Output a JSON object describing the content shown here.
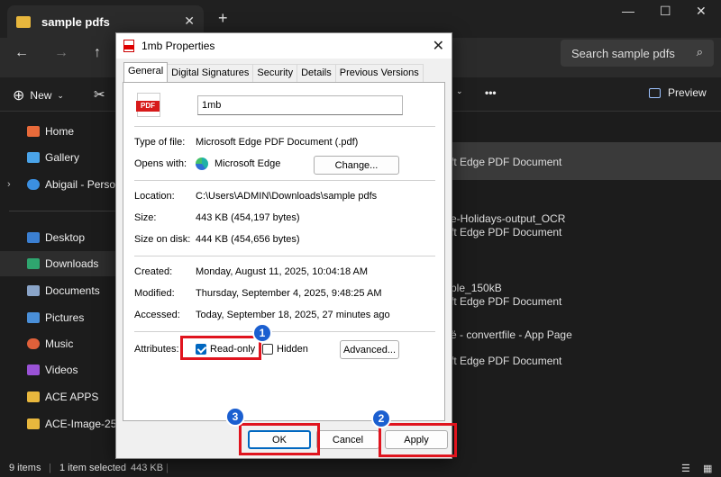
{
  "explorer": {
    "tab_title": "sample pdfs",
    "search_placeholder": "Search sample pdfs",
    "toolbar": {
      "new_label": "New",
      "preview_label": "Preview",
      "more": "•••"
    },
    "sidebar": [
      {
        "label": "Home",
        "color": "#e86a3a"
      },
      {
        "label": "Gallery",
        "color": "#4aa3e8"
      },
      {
        "label": "Abigail - Personal",
        "color": "#3b8fe0"
      },
      {
        "label": "Desktop",
        "color": "#3b7fd1"
      },
      {
        "label": "Downloads",
        "color": "#2fa56f"
      },
      {
        "label": "Documents",
        "color": "#8aa4c8"
      },
      {
        "label": "Pictures",
        "color": "#4a8fd8"
      },
      {
        "label": "Music",
        "color": "#e0603a"
      },
      {
        "label": "Videos",
        "color": "#9a52d6"
      },
      {
        "label": "ACE APPS",
        "color": "#e8b73d"
      },
      {
        "label": "ACE-Image-25-",
        "color": "#e8b73d"
      }
    ],
    "files": [
      "ft Edge PDF Document",
      "e-Holidays-output_OCR",
      "ft Edge PDF Document",
      "ple_150kB",
      "ft Edge PDF Document",
      "ë - convertfile - App Page",
      "ft Edge PDF Document"
    ],
    "status": {
      "items": "9 items",
      "selected": "1 item selected",
      "size": "443 KB"
    }
  },
  "dialog": {
    "title": "1mb Properties",
    "tabs": [
      "General",
      "Digital Signatures",
      "Security",
      "Details",
      "Previous Versions"
    ],
    "pdf_badge": "PDF",
    "file_name": "1mb",
    "type_label": "Type of file:",
    "type_value": "Microsoft Edge PDF Document (.pdf)",
    "opens_label": "Opens with:",
    "opens_value": "Microsoft Edge",
    "change_button": "Change...",
    "location_label": "Location:",
    "location_value": "C:\\Users\\ADMIN\\Downloads\\sample pdfs",
    "size_label": "Size:",
    "size_value": "443 KB (454,197 bytes)",
    "sizeondisk_label": "Size on disk:",
    "sizeondisk_value": "444 KB (454,656 bytes)",
    "created_label": "Created:",
    "created_value": "Monday, August 11, 2025, 10:04:18 AM",
    "modified_label": "Modified:",
    "modified_value": "Thursday, September 4, 2025, 9:48:25 AM",
    "accessed_label": "Accessed:",
    "accessed_value": "Today, September 18, 2025, 27 minutes ago",
    "attributes_label": "Attributes:",
    "readonly_label": "Read-only",
    "readonly_checked": true,
    "hidden_label": "Hidden",
    "hidden_checked": false,
    "advanced_button": "Advanced...",
    "ok_button": "OK",
    "cancel_button": "Cancel",
    "apply_button": "Apply"
  },
  "annotations": {
    "step1": "1",
    "step2": "2",
    "step3": "3",
    "color": "#e0141e",
    "badge_color": "#1b5fd0"
  }
}
